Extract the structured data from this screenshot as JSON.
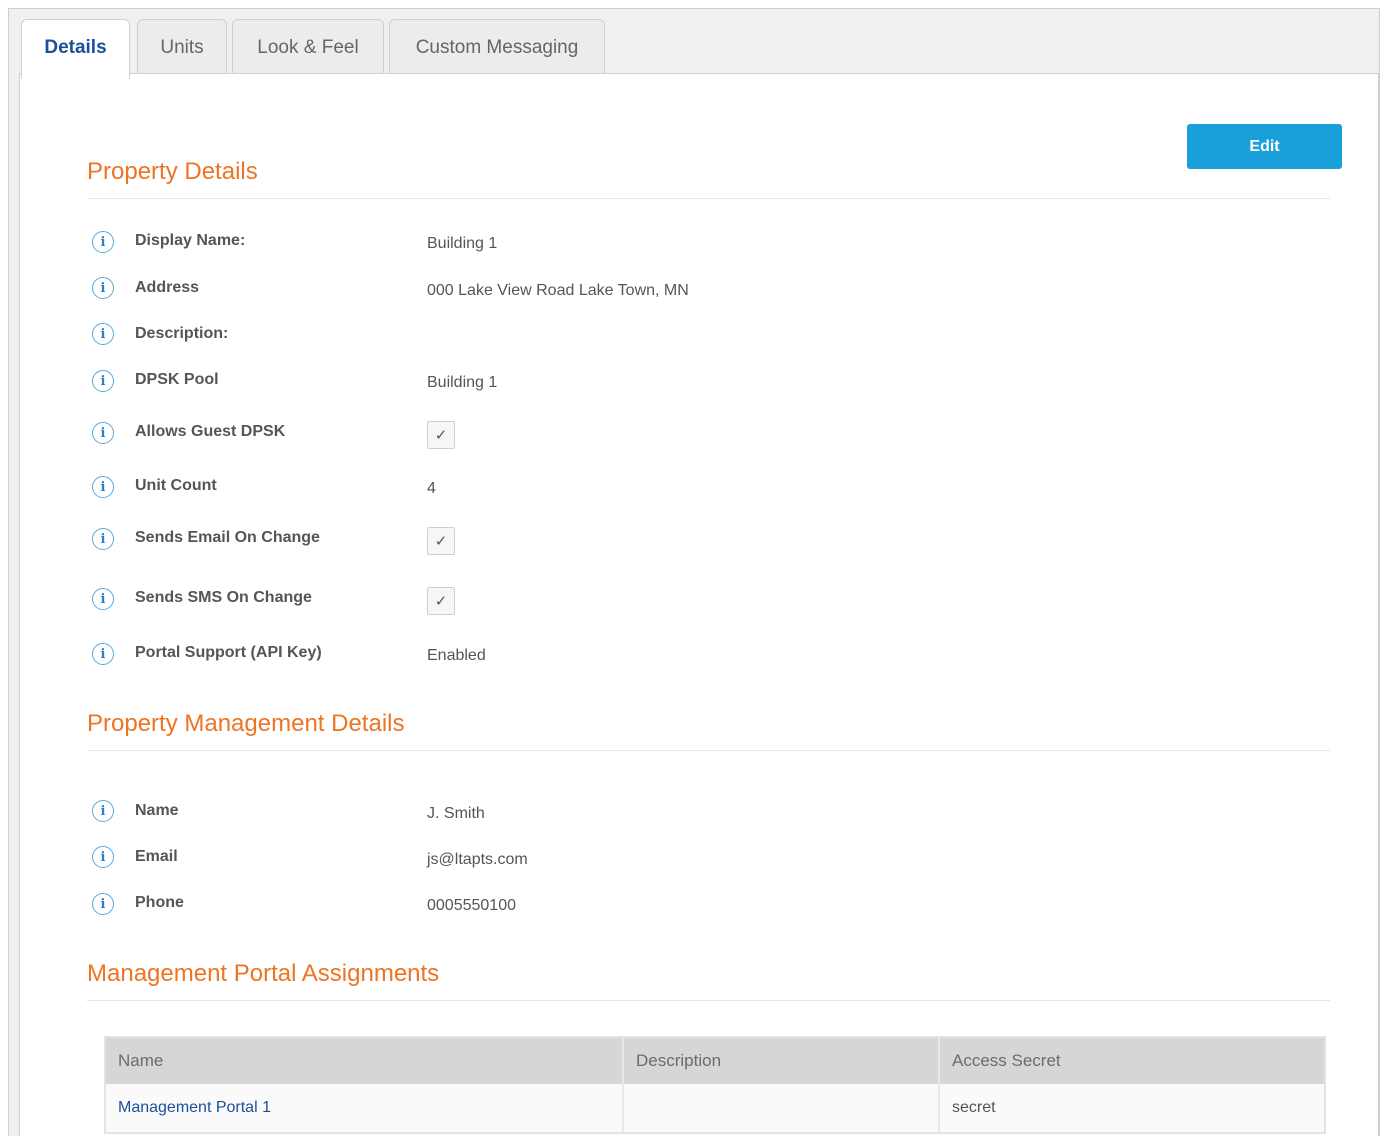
{
  "tabs": [
    {
      "label": "Details",
      "active": true
    },
    {
      "label": "Units",
      "active": false
    },
    {
      "label": "Look & Feel",
      "active": false
    },
    {
      "label": "Custom Messaging",
      "active": false
    }
  ],
  "edit_label": "Edit",
  "property_details": {
    "title": "Property Details",
    "fields": [
      {
        "label": "Display Name:",
        "value": "Building 1"
      },
      {
        "label": "Address",
        "value": "000 Lake View Road Lake Town, MN"
      },
      {
        "label": "Description:",
        "value": ""
      },
      {
        "label": "DPSK Pool",
        "value": "Building 1"
      },
      {
        "label": "Allows Guest DPSK",
        "checked": true
      },
      {
        "label": "Unit Count",
        "value": "4"
      },
      {
        "label": "Sends Email On Change",
        "checked": true
      },
      {
        "label": "Sends SMS On Change",
        "checked": true
      },
      {
        "label": "Portal Support (API Key)",
        "value": "Enabled"
      }
    ]
  },
  "management_details": {
    "title": "Property Management Details",
    "fields": [
      {
        "label": "Name",
        "value": "J. Smith"
      },
      {
        "label": "Email",
        "value": "js@ltapts.com"
      },
      {
        "label": "Phone",
        "value": "0005550100"
      }
    ]
  },
  "portal_assignments": {
    "title": "Management Portal Assignments",
    "columns": [
      "Name",
      "Description",
      "Access Secret"
    ],
    "rows": [
      {
        "name": "Management Portal 1",
        "description": "",
        "access_secret": "secret"
      }
    ]
  },
  "icons": {
    "info": "info-icon",
    "check": "check-icon"
  },
  "colors": {
    "accent": "#ee7423",
    "button": "#19a0db",
    "link": "#1b4f9c"
  }
}
